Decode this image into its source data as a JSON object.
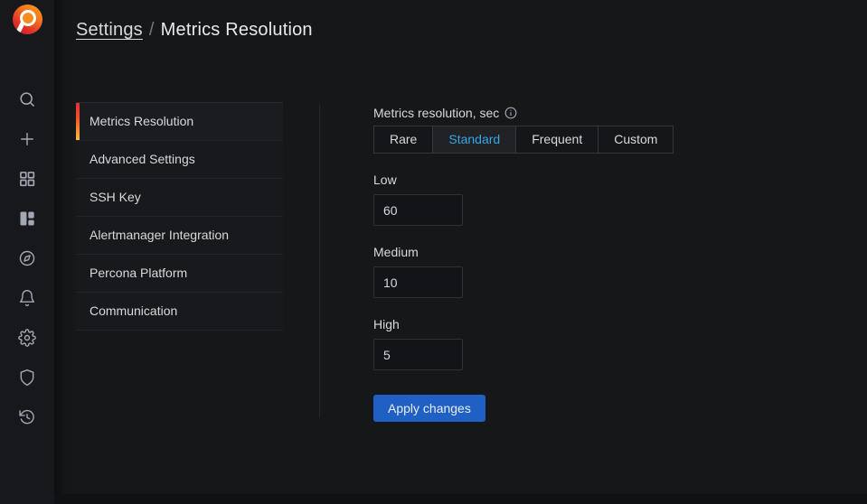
{
  "header": {
    "breadcrumb": {
      "section_label": "Settings",
      "separator": "/",
      "page_label": "Metrics Resolution"
    }
  },
  "sidebar": {
    "icons": [
      "search",
      "plus",
      "apps-grid",
      "panels",
      "compass",
      "bell",
      "gear",
      "shield",
      "history"
    ]
  },
  "settings_menu": {
    "items": [
      {
        "label": "Metrics Resolution",
        "active": true
      },
      {
        "label": "Advanced Settings",
        "active": false
      },
      {
        "label": "SSH Key",
        "active": false
      },
      {
        "label": "Alertmanager Integration",
        "active": false
      },
      {
        "label": "Percona Platform",
        "active": false
      },
      {
        "label": "Communication",
        "active": false
      }
    ]
  },
  "form": {
    "resolution_label": "Metrics resolution, sec",
    "info_icon": "info-circle",
    "tabs": [
      {
        "label": "Rare",
        "selected": false
      },
      {
        "label": "Standard",
        "selected": true
      },
      {
        "label": "Frequent",
        "selected": false
      },
      {
        "label": "Custom",
        "selected": false
      }
    ],
    "fields": [
      {
        "label": "Low",
        "value": "60"
      },
      {
        "label": "Medium",
        "value": "10"
      },
      {
        "label": "High",
        "value": "5"
      }
    ],
    "apply_button_label": "Apply changes"
  },
  "colors": {
    "accent_blue": "#36a6e8",
    "primary_button_blue": "#1f60c4",
    "active_indicator_top": "#e8293b",
    "active_indicator_bottom": "#fbbe3c",
    "logo_red": "#e02c26",
    "logo_orange": "#f78c1e"
  }
}
